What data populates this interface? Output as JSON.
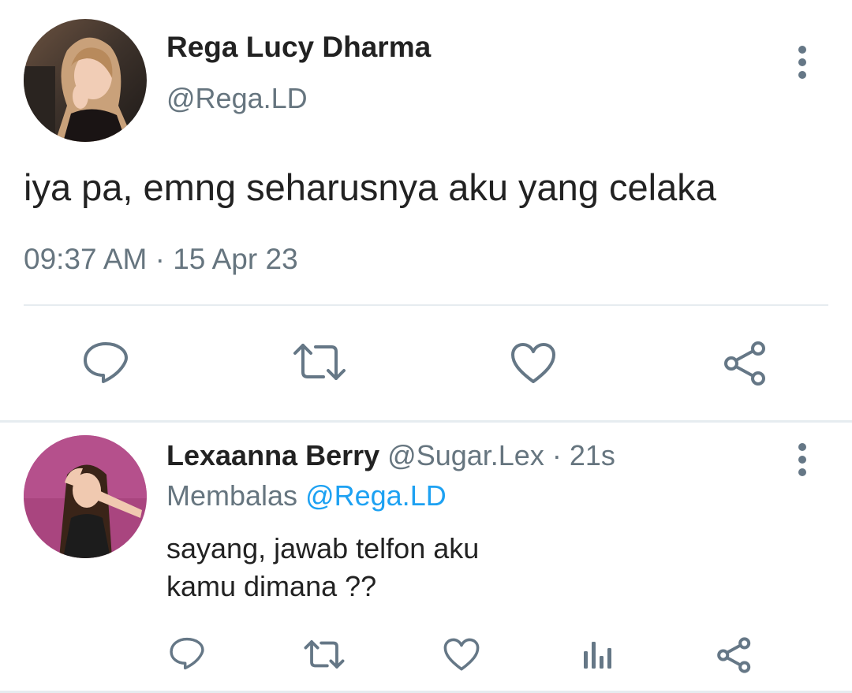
{
  "main_tweet": {
    "author_name": "Rega Lucy Dharma",
    "author_handle": "@Rega.LD",
    "text": "iya pa, emng seharusnya aku yang celaka",
    "time": "09:37 AM",
    "separator": "·",
    "date": "15 Apr 23",
    "actions": [
      "reply-icon",
      "retweet-icon",
      "like-icon",
      "share-icon"
    ]
  },
  "reply_tweet": {
    "author_name": "Lexaanna Berry",
    "author_handle": "@Sugar.Lex",
    "age": "· 21s",
    "replying_prefix": "Membalas",
    "replying_to": "@Rega.LD",
    "text_line1": "sayang, jawab telfon aku",
    "text_line2": "kamu dimana ??",
    "actions": [
      "reply-icon",
      "retweet-icon",
      "like-icon",
      "analytics-icon",
      "share-icon"
    ]
  },
  "colors": {
    "accent": "#1da1f2",
    "muted": "#66757f",
    "icon": "#657786",
    "divider": "#e6ecf0"
  }
}
